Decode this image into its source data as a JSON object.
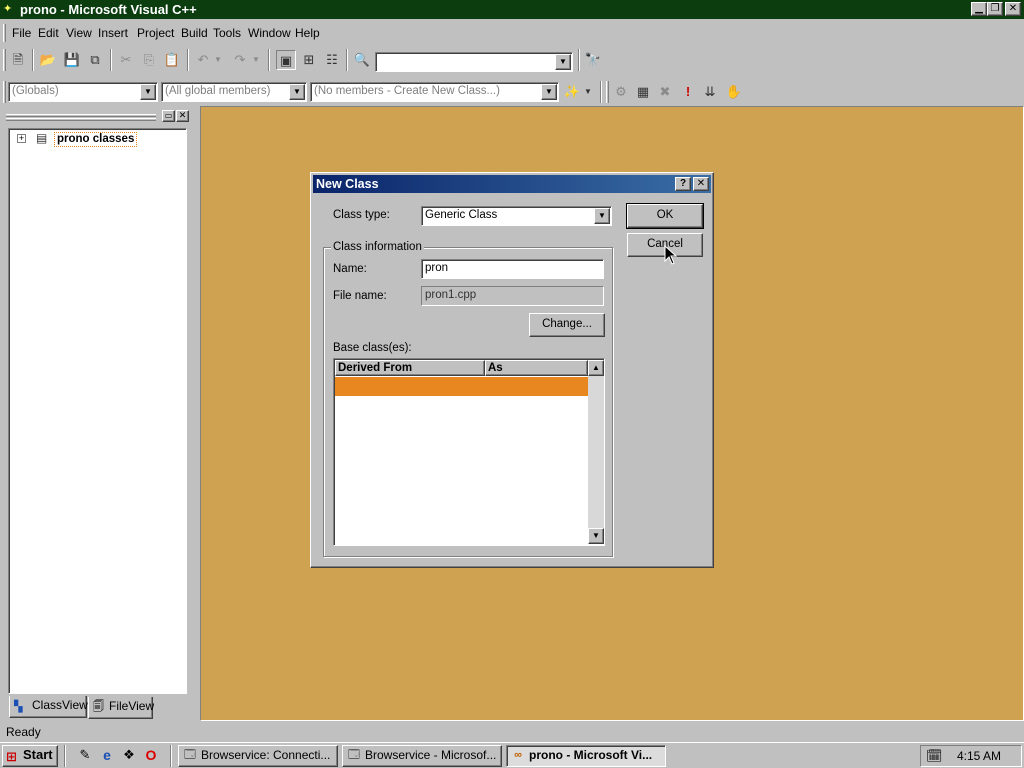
{
  "window": {
    "title": "prono - Microsoft Visual C++",
    "caption_buttons": [
      "minimize-icon",
      "restore-icon",
      "close-icon"
    ]
  },
  "menu": [
    "File",
    "Edit",
    "View",
    "Insert",
    "Project",
    "Build",
    "Tools",
    "Window",
    "Help"
  ],
  "toolbar": {
    "find_combo_value": ""
  },
  "wizardbar": {
    "scope_combo": "(Globals)",
    "members_combo": "(All global members)",
    "action_combo": "(No members - Create New Class...)"
  },
  "workspace": {
    "tree_root": "prono classes",
    "tabs": [
      {
        "label": "ClassView",
        "icon": "classview-icon"
      },
      {
        "label": "FileView",
        "icon": "fileview-icon"
      }
    ]
  },
  "dialog": {
    "title": "New Class",
    "class_type_label": "Class type:",
    "class_type_value": "Generic Class",
    "group_label": "Class information",
    "name_label": "Name:",
    "name_value": "pron",
    "file_name_label": "File name:",
    "file_name_value": "pron1.cpp",
    "change_button": "Change...",
    "base_classes_label": "Base class(es):",
    "columns": [
      "Derived From",
      "As"
    ],
    "ok_button": "OK",
    "cancel_button": "Cancel",
    "selected_row_color": "#e8861f"
  },
  "statusbar": {
    "text": "Ready"
  },
  "taskbar": {
    "start_label": "Start",
    "tasks": [
      {
        "label": "Browservice: Connecti...",
        "active": false
      },
      {
        "label": "Browservice - Microsof...",
        "active": false
      },
      {
        "label": "prono - Microsoft Vi...",
        "active": true
      }
    ],
    "clock": "4:15 AM"
  },
  "colors": {
    "titlebar": "#0b3d0f",
    "mdi_background": "#cfa251",
    "dialog_title": "#0a246a"
  }
}
